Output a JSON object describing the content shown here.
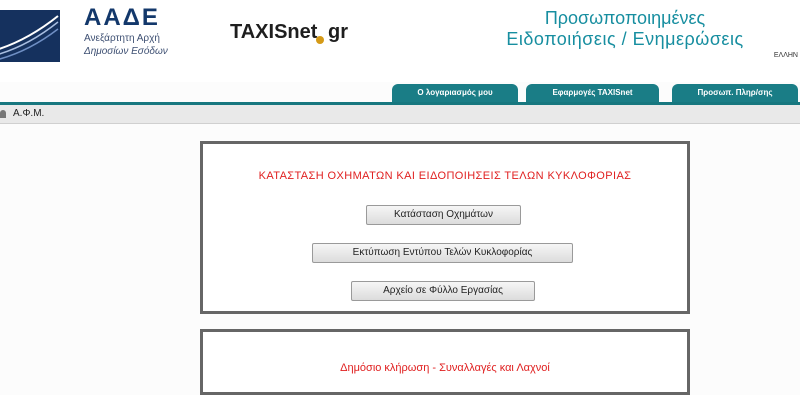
{
  "header": {
    "brand": "ΑΑΔΕ",
    "brand_sub_line1": "Ανεξάρτητη Αρχή",
    "brand_sub_line2": "Δημοσίων Εσόδων",
    "taxis_name": "TAXISnet",
    "taxis_suffix": "gr",
    "title_line1": "Προσωποποιημένες",
    "title_line2": "Ειδοποιήσεις / Ενημερώσεις",
    "language": "ΕΛΛΗΝ"
  },
  "tabs": [
    {
      "label": "Ο λογαριασμός μου"
    },
    {
      "label": "Εφαρμογές TAXISnet"
    },
    {
      "label": "Προσωπ. Πληρ/σης"
    }
  ],
  "breadcrumb": {
    "label": "Α.Φ.Μ."
  },
  "panel1": {
    "title": "ΚΑΤΑΣΤΑΣΗ ΟΧΗΜΑΤΩΝ ΚΑΙ ΕΙΔΟΠΟΙΗΣΕΙΣ ΤΕΛΩΝ ΚΥΚΛΟΦΟΡΙΑΣ",
    "buttons": [
      {
        "label": "Κατάσταση Οχημάτων"
      },
      {
        "label": "Εκτύπωση Εντύπου Τελών Κυκλοφορίας"
      },
      {
        "label": "Αρχείο σε Φύλλο Εργασίας"
      }
    ]
  },
  "panel2": {
    "title": "Δημόσιο κλήρωση - Συναλλαγές και Λαχνοί"
  },
  "colors": {
    "brand_navy": "#13386b",
    "teal": "#1a7d86",
    "alert_red": "#e02020",
    "gold": "#d59a17"
  }
}
